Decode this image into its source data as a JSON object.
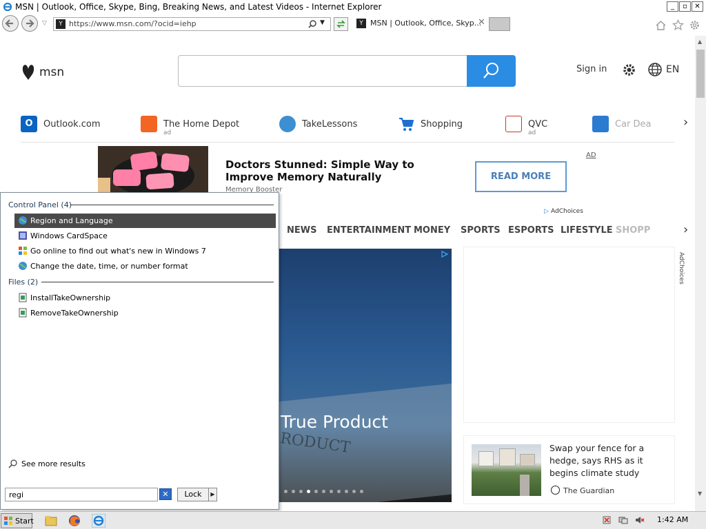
{
  "window": {
    "title": "MSN | Outlook, Office, Skype, Bing, Breaking News, and Latest Videos - Internet Explorer",
    "controls": {
      "minimize": "_",
      "maximize": "▫",
      "close": "✕"
    }
  },
  "browser": {
    "address": "https://www.msn.com/?ocid=iehp",
    "tab_title": "MSN | Outlook, Office, Skyp...",
    "tab_close": "✕"
  },
  "msn": {
    "logo_text": "msn",
    "sign_in": "Sign in",
    "language": "EN"
  },
  "quick_links": [
    {
      "label": "Outlook.com",
      "ad": ""
    },
    {
      "label": "The Home Depot",
      "ad": "ad"
    },
    {
      "label": "TakeLessons",
      "ad": ""
    },
    {
      "label": "Shopping",
      "ad": ""
    },
    {
      "label": "QVC",
      "ad": "ad"
    },
    {
      "label": "Car Deal",
      "ad": ""
    }
  ],
  "ad_banner": {
    "headline": "Doctors Stunned: Simple Way to Improve Memory Naturally",
    "sponsor": "Memory Booster",
    "cta": "READ MORE",
    "tag": "AD",
    "adchoices": "AdChoices"
  },
  "categories": [
    "NEWS",
    "ENTERTAINMENT",
    "MONEY",
    "SPORTS",
    "ESPORTS",
    "LIFESTYLE",
    "SHOPP"
  ],
  "hero": {
    "title": "True Product",
    "stamp": "RODUCT",
    "dot_count": 11,
    "active_dot": 3
  },
  "right_column": {
    "adchoices": "AdChoices",
    "card": {
      "headline": "Swap your fence for a hedge, says RHS as it begins climate study",
      "source": "The Guardian"
    }
  },
  "start_menu": {
    "sections": [
      {
        "title": "Control Panel (4)",
        "items": [
          {
            "label": "Region and Language",
            "selected": true
          },
          {
            "label": "Windows CardSpace",
            "selected": false
          },
          {
            "label": "Go online to find out what's new in Windows 7",
            "selected": false
          },
          {
            "label": "Change the date, time, or number format",
            "selected": false
          }
        ]
      },
      {
        "title": "Files (2)",
        "items": [
          {
            "label": "InstallTakeOwnership",
            "selected": false
          },
          {
            "label": "RemoveTakeOwnership",
            "selected": false
          }
        ]
      }
    ],
    "see_more": "See more results",
    "search_value": "regi",
    "lock_label": "Lock",
    "clear_glyph": "✕",
    "arrow_glyph": "▶"
  },
  "taskbar": {
    "start_label": "Start",
    "clock": "1:42 AM"
  },
  "colors": {
    "search_button": "#2b8ce4",
    "selection": "#4a4a4a",
    "read_more_border": "#5b9bd5"
  },
  "icons": {
    "back": "back-arrow-icon",
    "forward": "forward-arrow-icon",
    "search": "magnifier-icon",
    "home": "home-icon",
    "favorites": "star-icon",
    "settings": "gear-icon",
    "globe": "globe-icon"
  }
}
